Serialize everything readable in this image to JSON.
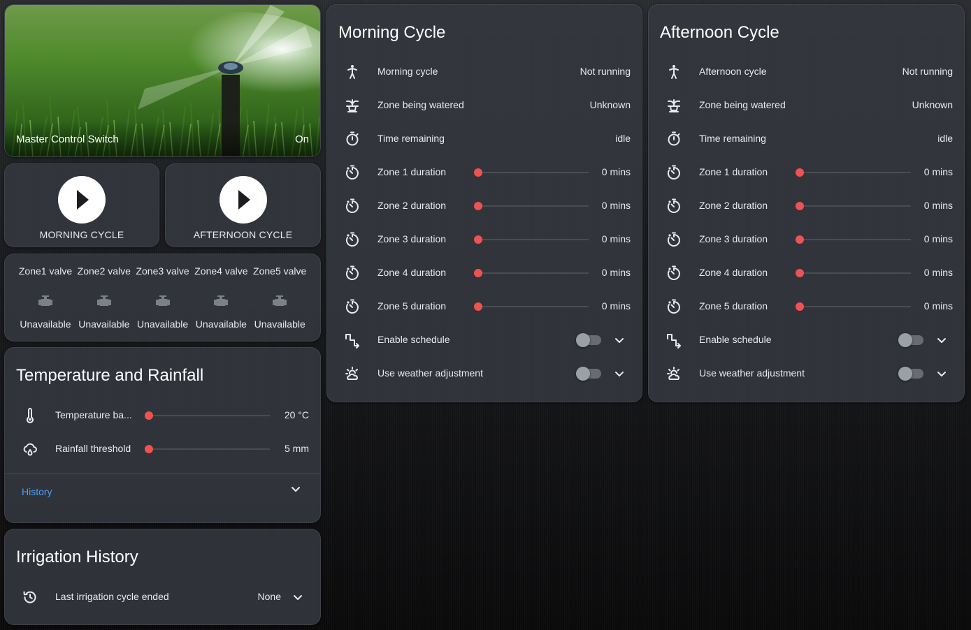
{
  "master": {
    "name": "Master Control Switch",
    "state": "On"
  },
  "buttons": [
    {
      "label": "MORNING CYCLE",
      "icon": "play-icon"
    },
    {
      "label": "AFTERNOON CYCLE",
      "icon": "play-icon"
    }
  ],
  "valves": [
    {
      "name": "Zone1 valve",
      "state": "Unavailable",
      "icon": "valve-icon"
    },
    {
      "name": "Zone2 valve",
      "state": "Unavailable",
      "icon": "valve-icon"
    },
    {
      "name": "Zone3 valve",
      "state": "Unavailable",
      "icon": "valve-icon"
    },
    {
      "name": "Zone4 valve",
      "state": "Unavailable",
      "icon": "valve-icon"
    },
    {
      "name": "Zone5 valve",
      "state": "Unavailable",
      "icon": "valve-icon"
    }
  ],
  "morning": {
    "title": "Morning Cycle",
    "rows": [
      {
        "label": "Morning cycle",
        "value": "Not running",
        "icon": "person-icon"
      },
      {
        "label": "Zone being watered",
        "value": "Unknown",
        "icon": "fountain-icon"
      },
      {
        "label": "Time remaining",
        "value": "idle",
        "icon": "timer-icon"
      },
      {
        "label": "Zone 1 duration",
        "value": "0 mins",
        "icon": "timer-cog-icon",
        "slider_fraction": 0
      },
      {
        "label": "Zone 2 duration",
        "value": "0 mins",
        "icon": "timer-cog-icon",
        "slider_fraction": 0
      },
      {
        "label": "Zone 3 duration",
        "value": "0 mins",
        "icon": "timer-cog-icon",
        "slider_fraction": 0
      },
      {
        "label": "Zone 4 duration",
        "value": "0 mins",
        "icon": "timer-cog-icon",
        "slider_fraction": 0
      },
      {
        "label": "Zone 5 duration",
        "value": "0 mins",
        "icon": "timer-cog-icon",
        "slider_fraction": 0
      },
      {
        "label": "Enable schedule",
        "icon": "schedule-icon",
        "toggle": false
      },
      {
        "label": "Use weather adjustment",
        "icon": "weather-icon",
        "toggle": false
      }
    ]
  },
  "afternoon": {
    "title": "Afternoon Cycle",
    "rows": [
      {
        "label": "Afternoon cycle",
        "value": "Not running",
        "icon": "person-icon"
      },
      {
        "label": "Zone being watered",
        "value": "Unknown",
        "icon": "fountain-icon"
      },
      {
        "label": "Time remaining",
        "value": "idle",
        "icon": "timer-icon"
      },
      {
        "label": "Zone 1 duration",
        "value": "0 mins",
        "icon": "timer-cog-icon",
        "slider_fraction": 0
      },
      {
        "label": "Zone 2 duration",
        "value": "0 mins",
        "icon": "timer-cog-icon",
        "slider_fraction": 0
      },
      {
        "label": "Zone 3 duration",
        "value": "0 mins",
        "icon": "timer-cog-icon",
        "slider_fraction": 0
      },
      {
        "label": "Zone 4 duration",
        "value": "0 mins",
        "icon": "timer-cog-icon",
        "slider_fraction": 0
      },
      {
        "label": "Zone 5 duration",
        "value": "0 mins",
        "icon": "timer-cog-icon",
        "slider_fraction": 0
      },
      {
        "label": "Enable schedule",
        "icon": "schedule-icon",
        "toggle": false
      },
      {
        "label": "Use weather adjustment",
        "icon": "weather-icon",
        "toggle": false
      }
    ]
  },
  "temperature": {
    "title": "Temperature and Rainfall",
    "rows": [
      {
        "label": "Temperature ba...",
        "value": "20 °C",
        "icon": "thermometer-icon",
        "slider_fraction": 0
      },
      {
        "label": "Rainfall threshold",
        "value": "5 mm",
        "icon": "rain-cloud-icon",
        "slider_fraction": 0
      }
    ],
    "history_label": "History"
  },
  "irrigation_history": {
    "title": "Irrigation History",
    "last_label": "Last irrigation cycle ended",
    "last_value": "None",
    "icon": "history-icon"
  },
  "colors": {
    "accent": "#ef5350",
    "link": "#4a9ff5",
    "card": "#34383f"
  }
}
